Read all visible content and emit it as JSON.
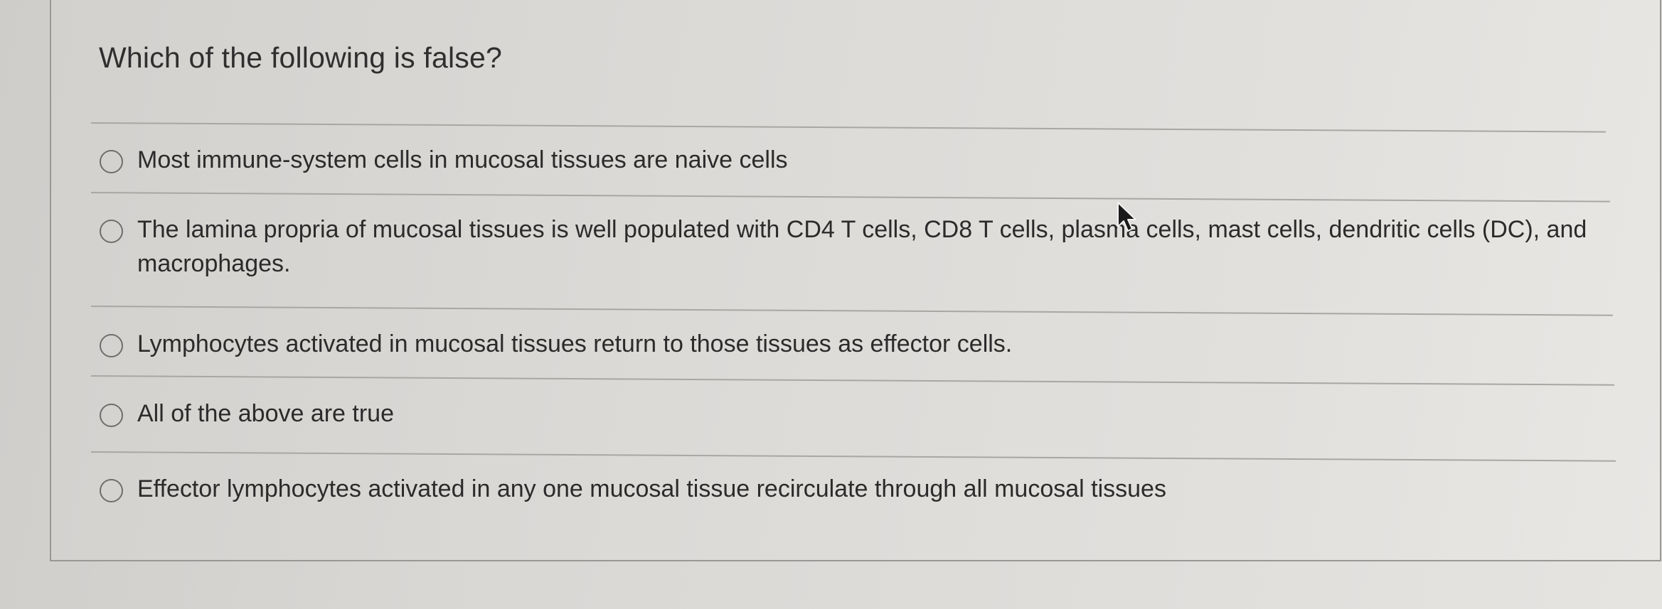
{
  "question": {
    "text": "Which of the following is false?"
  },
  "options": [
    {
      "label": "Most immune-system cells in mucosal tissues are naive cells",
      "selected": false
    },
    {
      "label": "The lamina propria of mucosal tissues is well populated with CD4 T cells, CD8 T cells, plasma cells, mast cells, dendritic cells (DC), and",
      "label_line2": "macrophages.",
      "selected": false
    },
    {
      "label": "Lymphocytes activated in mucosal tissues return to those tissues as effector cells.",
      "selected": false
    },
    {
      "label": "All of the above are true",
      "selected": false
    },
    {
      "label": "Effector lymphocytes activated in any one mucosal tissue recirculate through all mucosal tissues",
      "selected": false
    }
  ],
  "cursor": {
    "icon": "mouse-pointer-icon"
  }
}
